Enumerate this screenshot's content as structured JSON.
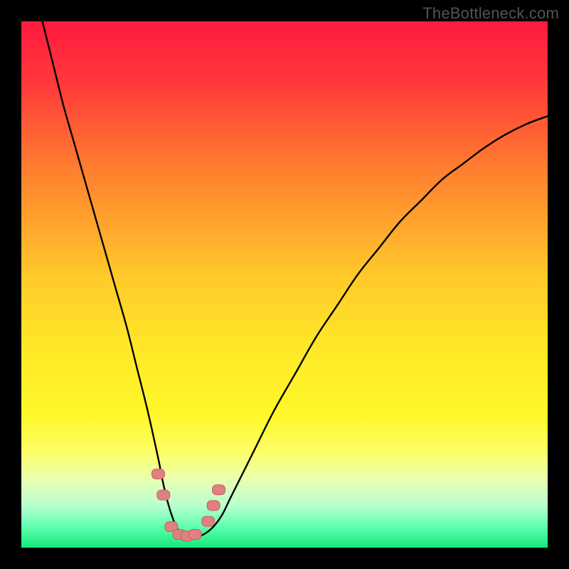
{
  "watermark": {
    "text": "TheBottleneck.com"
  },
  "colors": {
    "gradient_stops": [
      {
        "offset": 0.0,
        "color": "#ff1a3f"
      },
      {
        "offset": 0.12,
        "color": "#ff3a3a"
      },
      {
        "offset": 0.28,
        "color": "#ff7e2f"
      },
      {
        "offset": 0.48,
        "color": "#ffc82a"
      },
      {
        "offset": 0.62,
        "color": "#ffe827"
      },
      {
        "offset": 0.75,
        "color": "#fff82a"
      },
      {
        "offset": 0.82,
        "color": "#fdff6a"
      },
      {
        "offset": 0.87,
        "color": "#e9ffb0"
      },
      {
        "offset": 0.92,
        "color": "#b8ffd0"
      },
      {
        "offset": 0.96,
        "color": "#5fffb0"
      },
      {
        "offset": 1.0,
        "color": "#14e87a"
      }
    ],
    "curve": "#000000",
    "marker_fill": "#e08080",
    "marker_stroke": "#c86060"
  },
  "chart_data": {
    "type": "line",
    "title": "",
    "xlabel": "",
    "ylabel": "",
    "xlim": [
      0,
      100
    ],
    "ylim": [
      0,
      100
    ],
    "series": [
      {
        "name": "bottleneck-curve",
        "x": [
          4,
          6,
          8,
          10,
          12,
          14,
          16,
          18,
          20,
          22,
          24,
          26,
          27,
          28,
          29,
          30,
          31,
          32,
          33,
          34,
          36,
          38,
          40,
          44,
          48,
          52,
          56,
          60,
          64,
          68,
          72,
          76,
          80,
          84,
          88,
          92,
          96,
          100
        ],
        "y": [
          100,
          92,
          84,
          77,
          70,
          63,
          56,
          49,
          42,
          34,
          26,
          17,
          12,
          8,
          5,
          3,
          2.2,
          2.0,
          2.0,
          2.2,
          3.5,
          6,
          10,
          18,
          26,
          33,
          40,
          46,
          52,
          57,
          62,
          66,
          70,
          73,
          76,
          78.5,
          80.5,
          82
        ]
      }
    ],
    "markers": {
      "name": "highlighted-points",
      "points": [
        {
          "x": 26.0,
          "y": 14.0
        },
        {
          "x": 27.0,
          "y": 10.0
        },
        {
          "x": 28.5,
          "y": 4.0
        },
        {
          "x": 30.0,
          "y": 2.5
        },
        {
          "x": 31.5,
          "y": 2.2
        },
        {
          "x": 33.0,
          "y": 2.5
        },
        {
          "x": 35.5,
          "y": 5.0
        },
        {
          "x": 36.5,
          "y": 8.0
        },
        {
          "x": 37.5,
          "y": 11.0
        }
      ]
    }
  }
}
